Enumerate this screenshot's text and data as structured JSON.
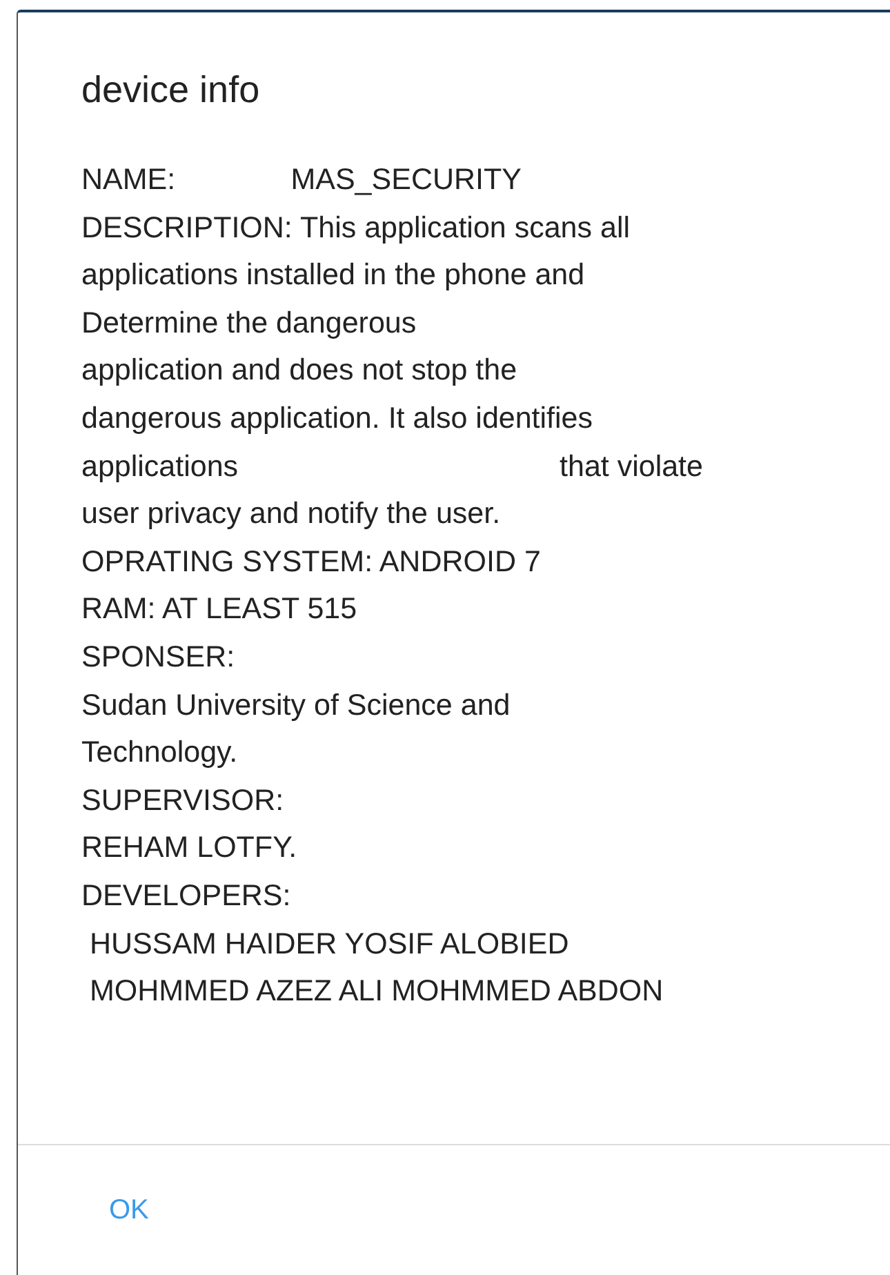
{
  "dialog": {
    "title": "device info",
    "lines": [
      "NAME:              MAS_SECURITY",
      "DESCRIPTION: This application scans all",
      "applications installed in the phone and",
      "Determine the dangerous",
      "application and does not stop the",
      "dangerous application. It also identifies",
      "applications                                       that violate",
      "user privacy and notify the user.",
      "OPRATING SYSTEM: ANDROID 7",
      "RAM: AT LEAST 515",
      "SPONSER:",
      "Sudan University of Science and",
      "Technology.",
      "SUPERVISOR:",
      "REHAM LOTFY.",
      "DEVELOPERS:",
      " HUSSAM HAIDER YOSIF ALOBIED",
      " MOHMMED AZEZ ALI MOHMMED ABDON"
    ],
    "buttons": [
      "OK"
    ]
  }
}
